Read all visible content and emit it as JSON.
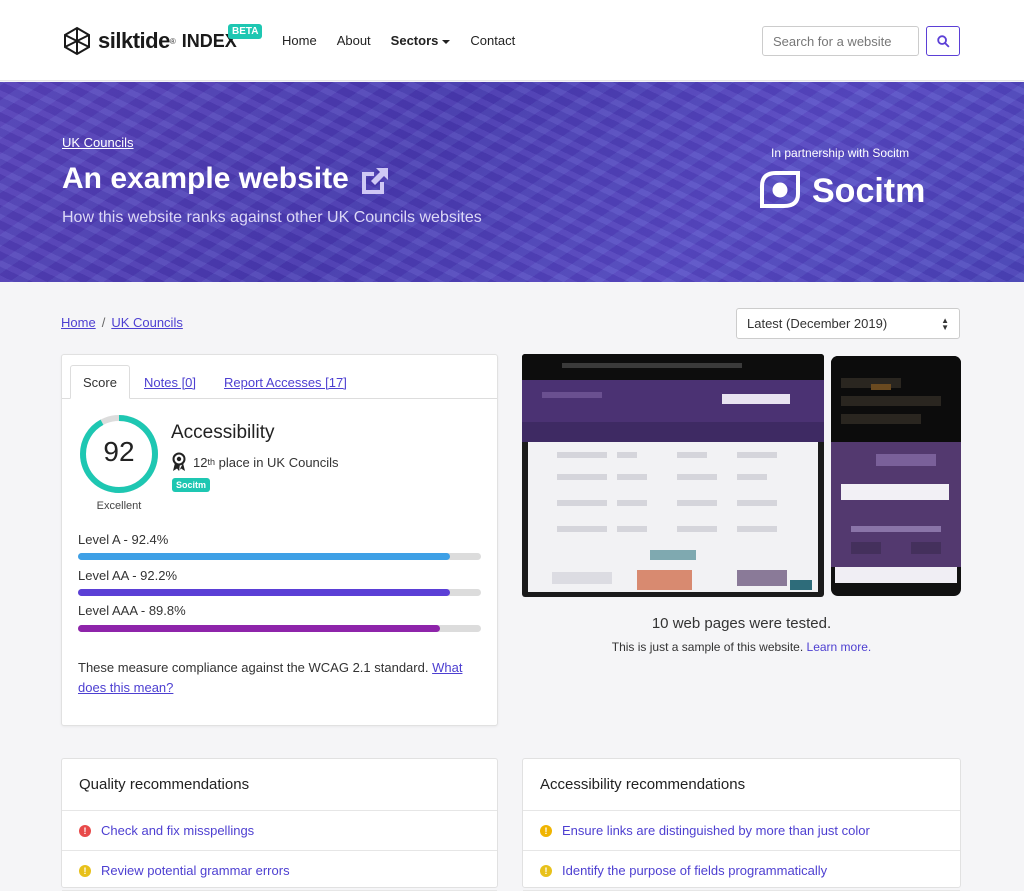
{
  "brand": {
    "name": "silktide",
    "reg": "®",
    "product": "INDEX",
    "badge": "BETA"
  },
  "nav": {
    "home": "Home",
    "about": "About",
    "sectors": "Sectors",
    "contact": "Contact"
  },
  "search": {
    "placeholder": "Search for a website",
    "icon": "search-icon"
  },
  "hero": {
    "crumb": "UK Councils",
    "title": "An example website",
    "subtitle": "How this website ranks against other UK Councils websites",
    "partner_text": "In partnership with Socitm",
    "partner_name": "Socitm"
  },
  "breadcrumb": {
    "home": "Home",
    "sep": "/",
    "current": "UK Councils"
  },
  "date_select": {
    "value": "Latest (December 2019)"
  },
  "score_card": {
    "tabs": [
      "Score",
      "Notes [0]",
      "Report Accesses [17]"
    ],
    "score": "92",
    "score_fraction": 0.92,
    "score_label": "Excellent",
    "title": "Accessibility",
    "rank_number": "12",
    "rank_suffix": "th",
    "rank_text": "place in UK Councils",
    "badge": "Socitm",
    "levels": [
      {
        "label": "Level A - 92.4%",
        "value": 92.4,
        "color": "#3ea0e6"
      },
      {
        "label": "Level AA - 92.2%",
        "value": 92.2,
        "color": "#5b3fd6"
      },
      {
        "label": "Level AAA - 89.8%",
        "value": 89.8,
        "color": "#8e24aa"
      }
    ],
    "measure_text": "These measure compliance against the WCAG 2.1 standard.",
    "measure_link": "What does this mean?"
  },
  "preview": {
    "tested": "10 web pages were tested.",
    "sample_text": "This is just a sample of this website.",
    "learn_more": "Learn more."
  },
  "quality": {
    "title": "Quality recommendations",
    "items": [
      {
        "text": "Check and fix misspellings",
        "severity": "error",
        "color": "#e84a4a"
      },
      {
        "text": "Review potential grammar errors",
        "severity": "warning",
        "color": "#e8c11a"
      }
    ]
  },
  "accessibility": {
    "title": "Accessibility recommendations",
    "items": [
      {
        "text": "Ensure links are distinguished by more than just color",
        "severity": "warning",
        "color": "#f0b400"
      },
      {
        "text": "Identify the purpose of fields programmatically",
        "severity": "warning",
        "color": "#e8c11a"
      }
    ]
  },
  "colors": {
    "accent": "#4d3fd1",
    "teal": "#1ec7b2",
    "gauge": "#1ec7b2"
  }
}
